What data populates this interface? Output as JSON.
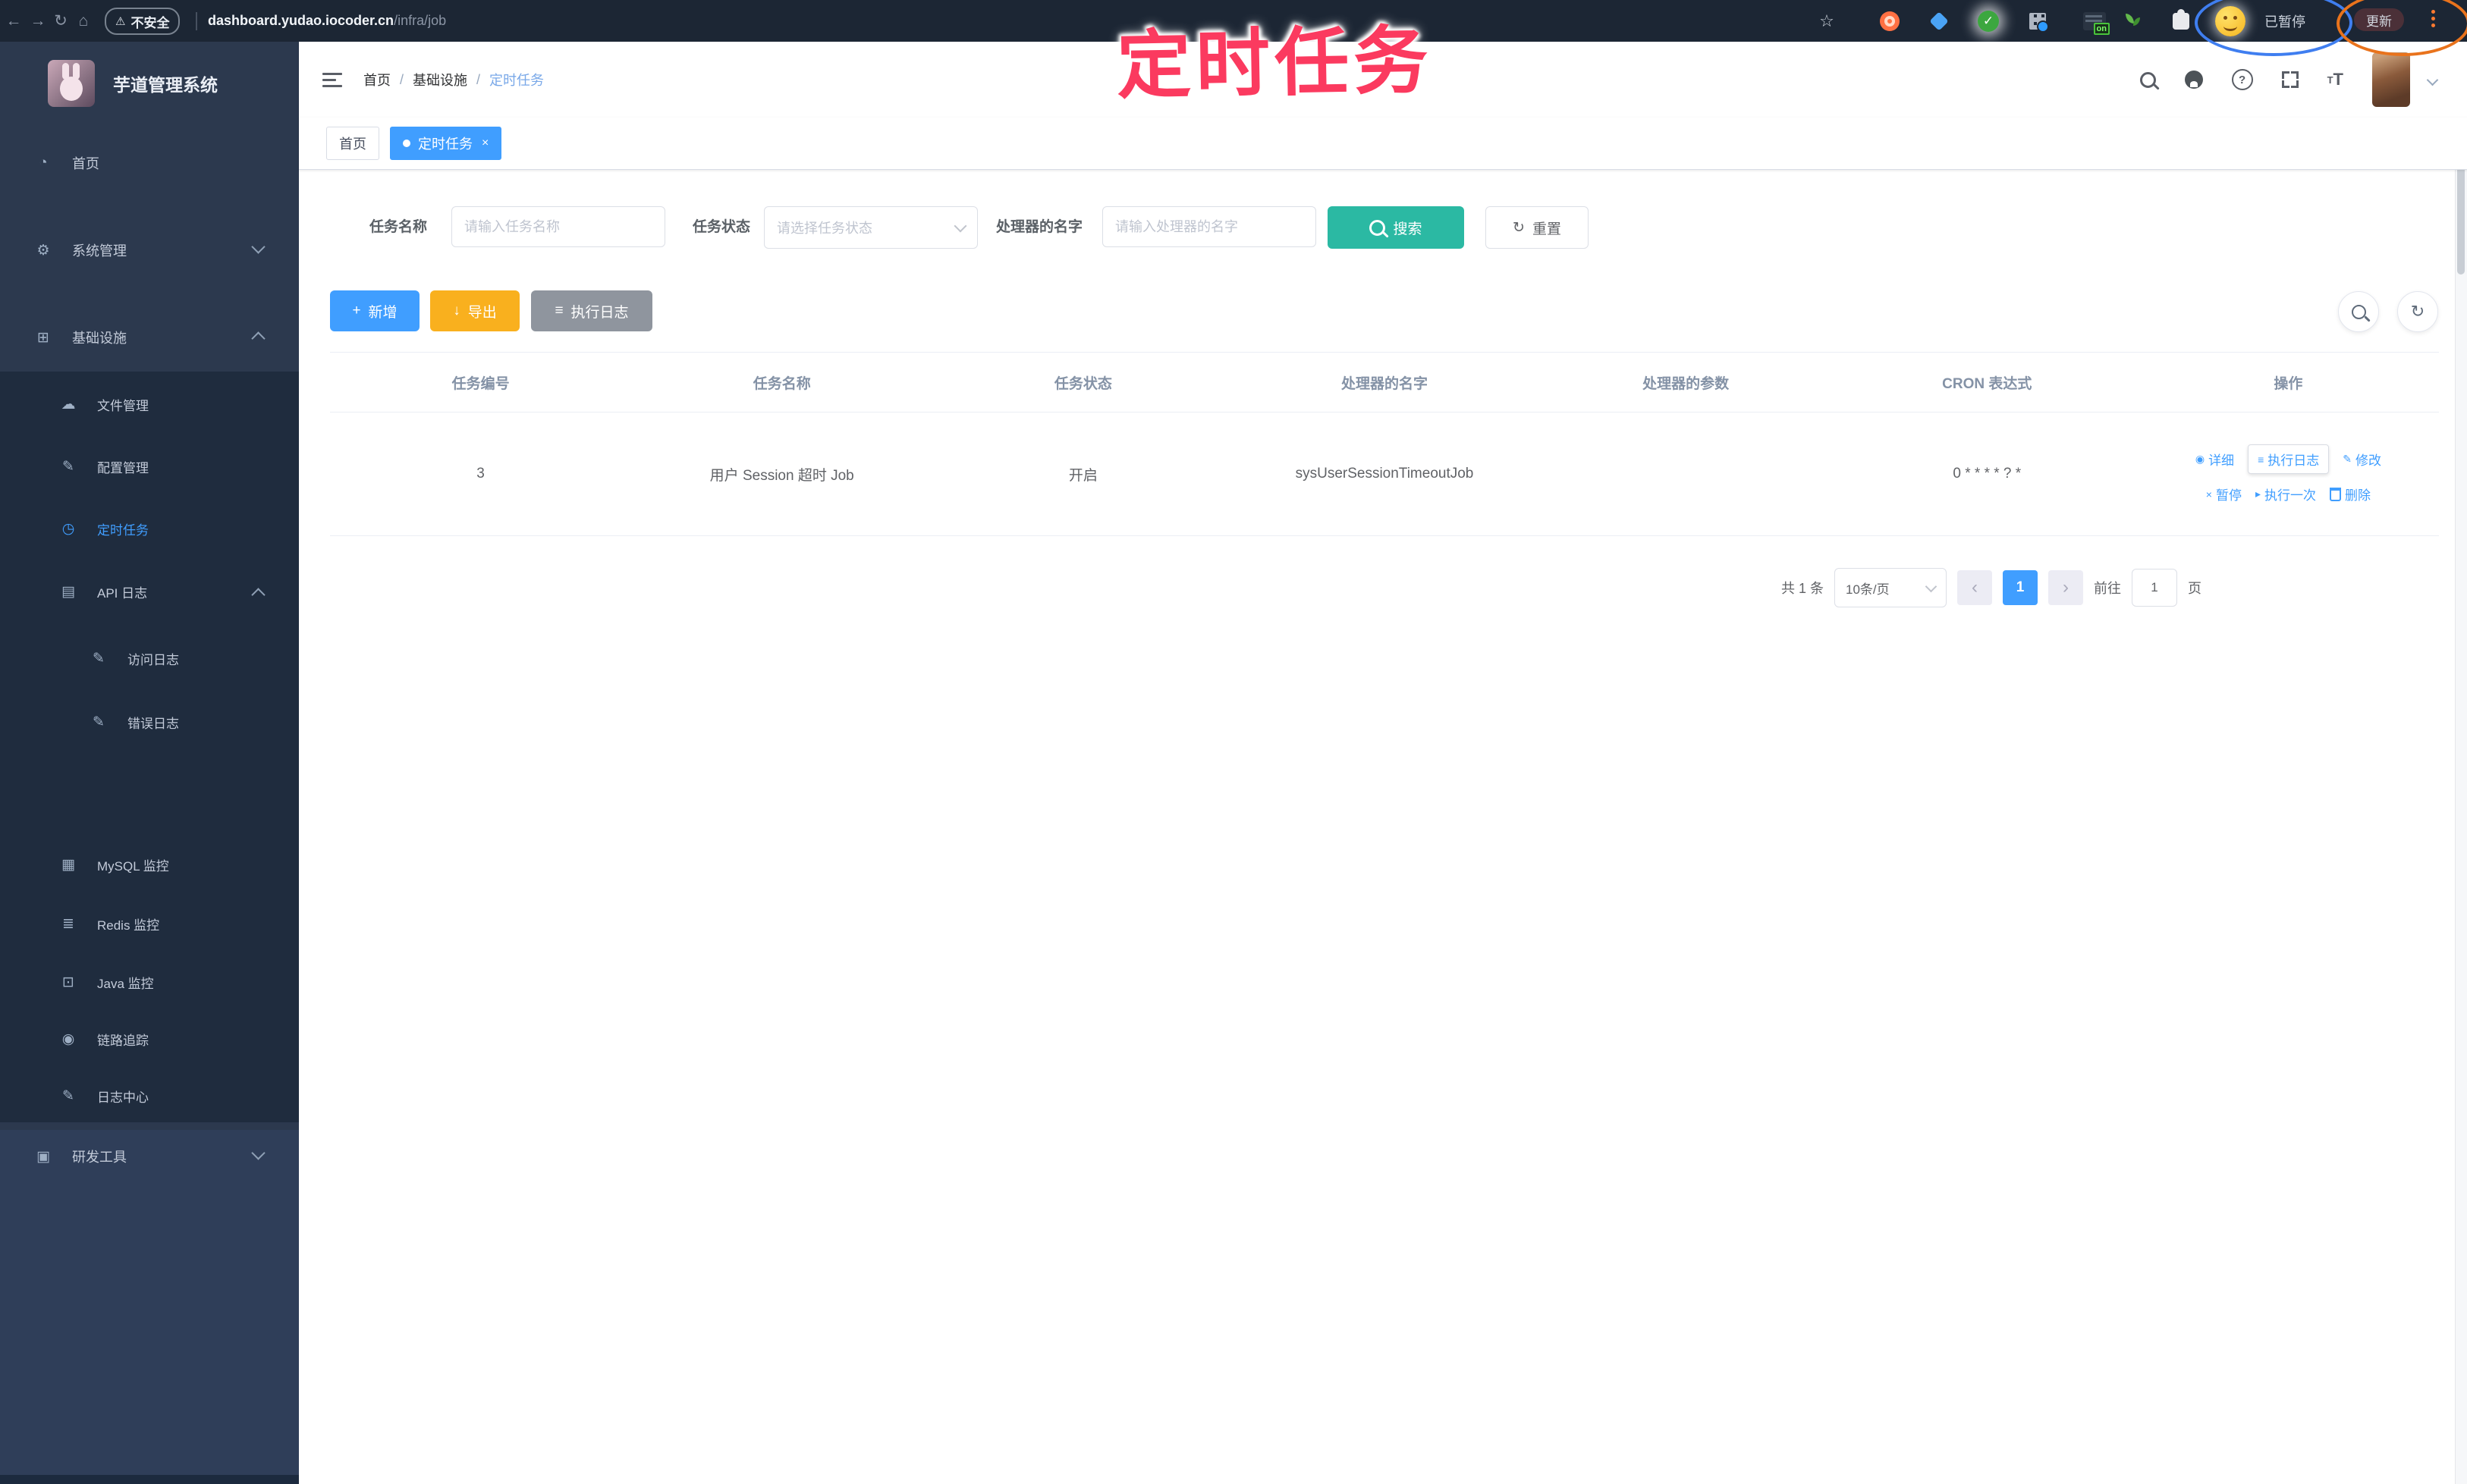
{
  "colors": {
    "accent_blue": "#409eff",
    "search_teal": "#2bb9a3",
    "export_amber": "#f9b01e",
    "info_gray": "#8f959e",
    "annotation_red": "#fb3a5f",
    "sidebar_bg": "#2c394e",
    "submenu_bg": "#1f2c3e",
    "browser_bg": "#1c2634"
  },
  "browser": {
    "security_label": "不安全",
    "url_host": "dashboard.yudao.iocoder.cn",
    "url_path": "/infra/job",
    "paused_label": "已暂停",
    "update_label": "更新",
    "on_badge": "on",
    "green_check": "✓"
  },
  "annotation": {
    "title": "定时任务"
  },
  "sidebar": {
    "logo_title": "芋道管理系统",
    "items": [
      {
        "label": "首页"
      },
      {
        "label": "系统管理"
      },
      {
        "label": "基础设施"
      },
      {
        "label": "文件管理"
      },
      {
        "label": "配置管理"
      },
      {
        "label": "定时任务"
      },
      {
        "label": "API 日志"
      },
      {
        "label": "访问日志"
      },
      {
        "label": "错误日志"
      },
      {
        "label": "MySQL 监控"
      },
      {
        "label": "Redis 监控"
      },
      {
        "label": "Java 监控"
      },
      {
        "label": "链路追踪"
      },
      {
        "label": "日志中心"
      },
      {
        "label": "研发工具"
      }
    ]
  },
  "navbar": {
    "breadcrumb": {
      "home": "首页",
      "section": "基础设施",
      "current": "定时任务"
    }
  },
  "tags": {
    "home": "首页",
    "current": "定时任务",
    "close": "×"
  },
  "filter": {
    "name_label": "任务名称",
    "name_placeholder": "请输入任务名称",
    "status_label": "任务状态",
    "status_placeholder": "请选择任务状态",
    "handler_label": "处理器的名字",
    "handler_placeholder": "请输入处理器的名字",
    "search": "搜索",
    "reset": "重置"
  },
  "toolbar": {
    "add": "新增",
    "export": "导出",
    "exec_log": "执行日志"
  },
  "table": {
    "headers": [
      "任务编号",
      "任务名称",
      "任务状态",
      "处理器的名字",
      "处理器的参数",
      "CRON 表达式",
      "操作"
    ],
    "row": {
      "id": "3",
      "name": "用户 Session 超时 Job",
      "status": "开启",
      "handler": "sysUserSessionTimeoutJob",
      "param": "",
      "cron": "0 * * * * ? *"
    },
    "ops": {
      "detail": "详细",
      "exec_log": "执行日志",
      "edit": "修改",
      "pause": "暂停",
      "run_once": "执行一次",
      "delete": "删除"
    }
  },
  "pagination": {
    "total": "共 1 条",
    "page_size": "10条/页",
    "page": "1",
    "goto": "前往",
    "goto_value": "1",
    "unit": "页"
  }
}
